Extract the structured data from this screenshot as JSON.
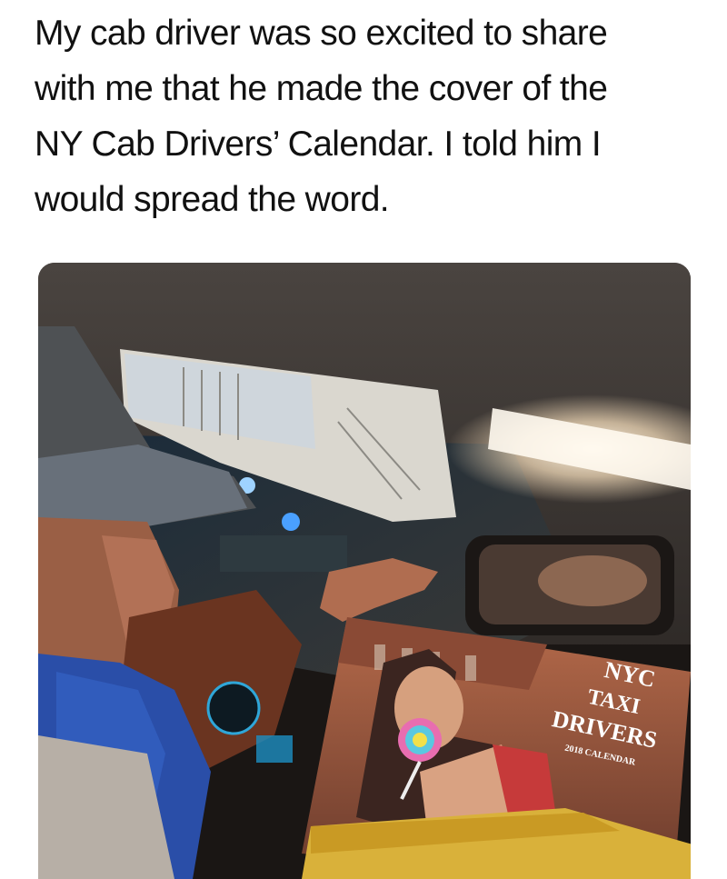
{
  "caption": {
    "lines": [
      "My cab driver was so excited to share",
      "with me that he made the cover of the",
      "NY Cab Drivers’ Calendar. I told him I",
      "would spread the word."
    ]
  },
  "photo": {
    "calendar": {
      "title_line1": "NYC",
      "title_line2": "TAXI",
      "title_line3": "DRIVERS",
      "subtitle": "2018 CALENDAR"
    }
  },
  "colors": {
    "background": "#ffffff",
    "text": "#111111"
  }
}
